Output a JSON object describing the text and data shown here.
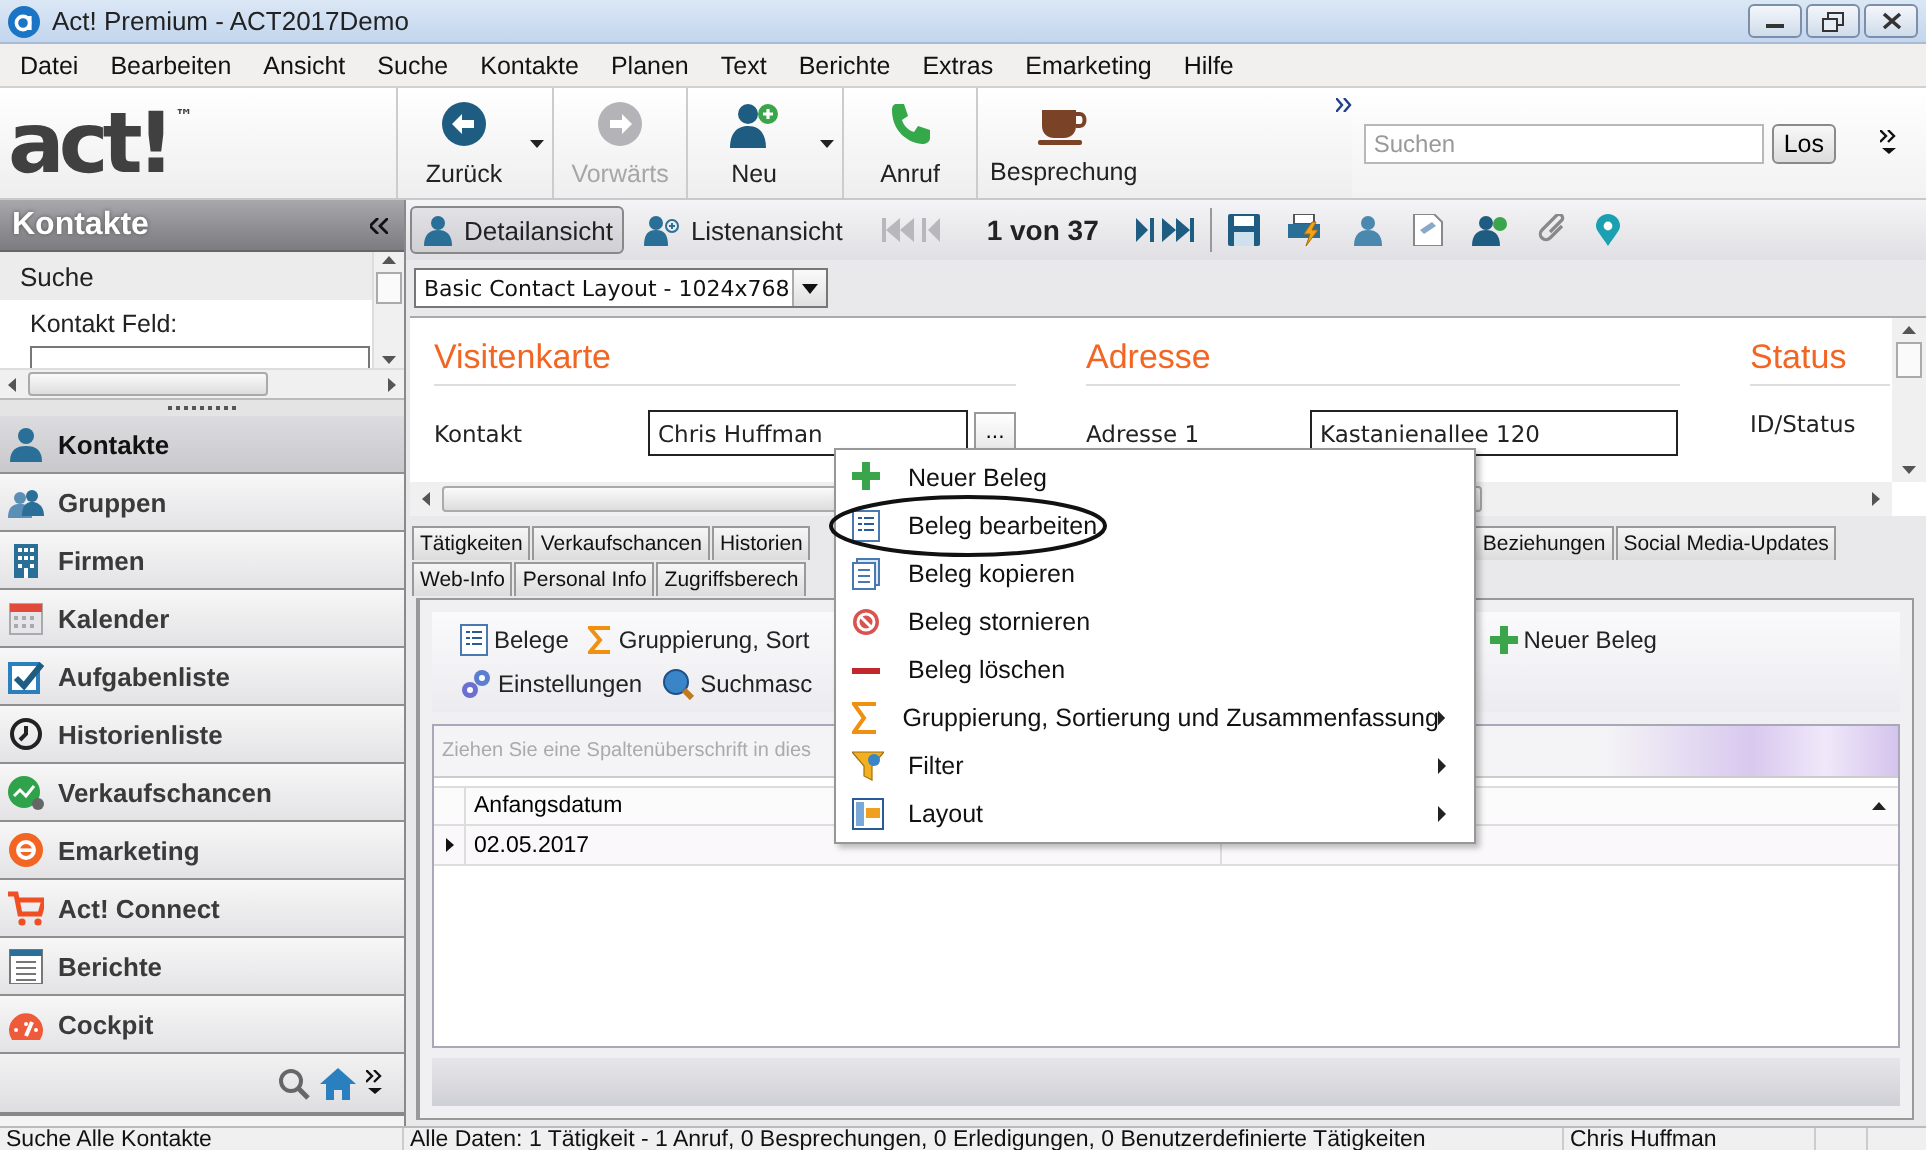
{
  "window": {
    "title": "Act! Premium - ACT2017Demo"
  },
  "menu_bar": [
    "Datei",
    "Bearbeiten",
    "Ansicht",
    "Suche",
    "Kontakte",
    "Planen",
    "Text",
    "Berichte",
    "Extras",
    "Emarketing",
    "Hilfe"
  ],
  "toolbar": {
    "logo": "act!$^{™}$",
    "buttons": [
      {
        "label": "Zurück",
        "disabled": false,
        "dropdown": true
      },
      {
        "label": "Vorwärts",
        "disabled": true,
        "dropdown": false
      },
      {
        "label": "Neu",
        "disabled": false,
        "dropdown": true
      },
      {
        "label": "Anruf",
        "disabled": false,
        "dropdown": false
      },
      {
        "label": "Besprechung",
        "disabled": false,
        "dropdown": false
      }
    ],
    "search": {
      "placeholder": "Suchen"
    },
    "search_button": "Los"
  },
  "sidebar": {
    "title": "Kontakte",
    "search_heading": "Suche",
    "search_field_label": "Kontakt Feld:",
    "items": [
      {
        "label": "Kontakte",
        "selected": true
      },
      {
        "label": "Gruppen",
        "selected": false
      },
      {
        "label": "Firmen",
        "selected": false
      },
      {
        "label": "Kalender",
        "selected": false
      },
      {
        "label": "Aufgabenliste",
        "selected": false
      },
      {
        "label": "Historienliste",
        "selected": false
      },
      {
        "label": "Verkaufschancen",
        "selected": false
      },
      {
        "label": "Emarketing",
        "selected": false
      },
      {
        "label": "Act! Connect",
        "selected": false
      },
      {
        "label": "Berichte",
        "selected": false
      },
      {
        "label": "Cockpit",
        "selected": false
      }
    ]
  },
  "record_bar": {
    "views": [
      {
        "label": "Detailansicht",
        "selected": true
      },
      {
        "label": "Listenansicht",
        "selected": false
      }
    ],
    "position": "1 von 37"
  },
  "layout_select": {
    "value": "Basic Contact Layout - 1024x768"
  },
  "detail": {
    "sections": [
      {
        "heading": "Visitenkarte",
        "fields": [
          {
            "label": "Kontakt",
            "value": "Chris Huffman",
            "picker_button": "..."
          }
        ]
      },
      {
        "heading": "Adresse",
        "fields": [
          {
            "label": "Adresse 1",
            "value": "Kastanienallee 120"
          }
        ]
      },
      {
        "heading": "Status",
        "fields": [
          {
            "label": "ID/Status"
          }
        ]
      }
    ]
  },
  "tabs": {
    "row_1_start": [
      "Tätigkeiten",
      "Verkaufschancen",
      "Historien"
    ],
    "row_1_end": [
      "Beziehungen",
      "Social Media-Updates"
    ],
    "row_2": [
      "Web-Info",
      "Personal Info",
      "Zugriffsberech"
    ]
  },
  "panel_toolbar": {
    "row_1": [
      "Belege",
      "Gruppierung, Sort"
    ],
    "row_1_end": [
      "Neuer Beleg"
    ],
    "row_2": [
      "Einstellungen",
      "Suchmasc"
    ]
  },
  "grid": {
    "group_hint": "Ziehen Sie eine Spaltenüberschrift in dies",
    "columns": [
      "Anfangsdatum"
    ],
    "rows": [
      {
        "cells": [
          "02.05.2017"
        ],
        "current": true
      }
    ]
  },
  "context_menu": {
    "items": [
      {
        "label": "Neuer Beleg",
        "submenu": false,
        "circled": false
      },
      {
        "label": "Beleg bearbeiten",
        "submenu": false,
        "circled": true
      },
      {
        "label": "Beleg kopieren",
        "submenu": false,
        "circled": false
      },
      {
        "label": "Beleg stornieren",
        "submenu": false,
        "circled": false
      },
      {
        "label": "Beleg löschen",
        "submenu": false,
        "circled": false
      },
      {
        "label": "Gruppierung, Sortierung und Zusammenfassung",
        "submenu": true,
        "circled": false
      },
      {
        "label": "Filter",
        "submenu": true,
        "circled": false
      },
      {
        "label": "Layout",
        "submenu": true,
        "circled": false
      }
    ]
  },
  "status_bar": [
    "Suche Alle Kontakte",
    "Alle Daten: 1 Tätigkeit - 1 Anruf, 0 Besprechungen, 0 Erledigungen, 0 Benutzerdefinierte Tätigkeiten",
    "Chris Huffman"
  ]
}
